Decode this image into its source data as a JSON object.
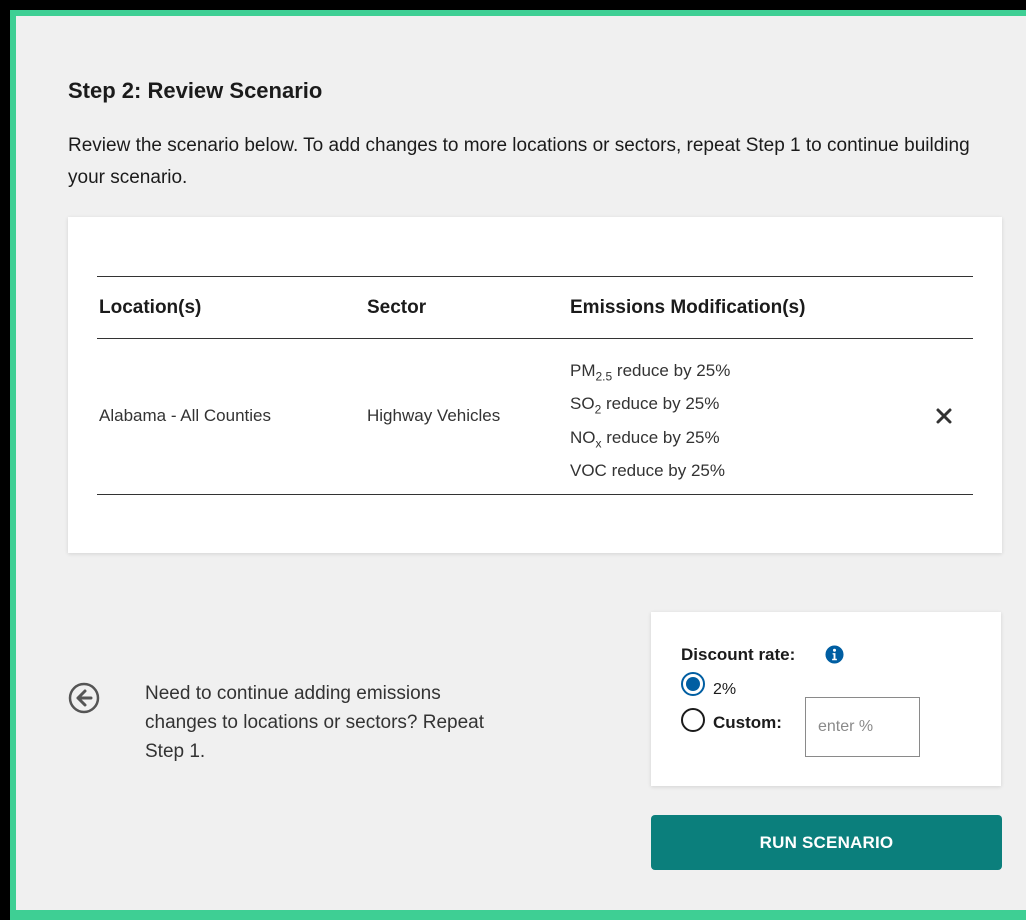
{
  "step": {
    "title": "Step 2: Review Scenario",
    "description": "Review the scenario below. To add changes to more locations or sectors, repeat Step 1 to continue building your scenario."
  },
  "table": {
    "headers": [
      "Location(s)",
      "Sector",
      "Emissions Modification(s)"
    ],
    "rows": [
      {
        "location": "Alabama - All Counties",
        "sector": "Highway Vehicles",
        "modifications": [
          {
            "pollutant": "PM",
            "sub": "2.5",
            "text": " reduce by 25%"
          },
          {
            "pollutant": "SO",
            "sub": "2",
            "text": " reduce by 25%"
          },
          {
            "pollutant": "NO",
            "sub": "x",
            "text": " reduce by 25%"
          },
          {
            "pollutant": "VOC",
            "sub": "",
            "text": " reduce by 25%"
          }
        ],
        "remove_icon": "close-icon"
      }
    ]
  },
  "back": {
    "icon": "arrow-left-circle-icon",
    "text": "Need to continue adding emissions changes to locations or sectors? Repeat Step 1."
  },
  "discount": {
    "label": "Discount rate:",
    "info_icon": "info-icon",
    "options": [
      {
        "label": "2%",
        "selected": true
      },
      {
        "label": "Custom:",
        "selected": false
      }
    ],
    "custom_placeholder": "enter %",
    "custom_value": ""
  },
  "run_button": {
    "label": "RUN SCENARIO"
  },
  "colors": {
    "frame_border": "#3ecf94",
    "panel_bg": "#f0f0f0",
    "primary_button": "#0b7f7c",
    "radio_selected": "#005ea2",
    "info_icon": "#005ea2"
  }
}
